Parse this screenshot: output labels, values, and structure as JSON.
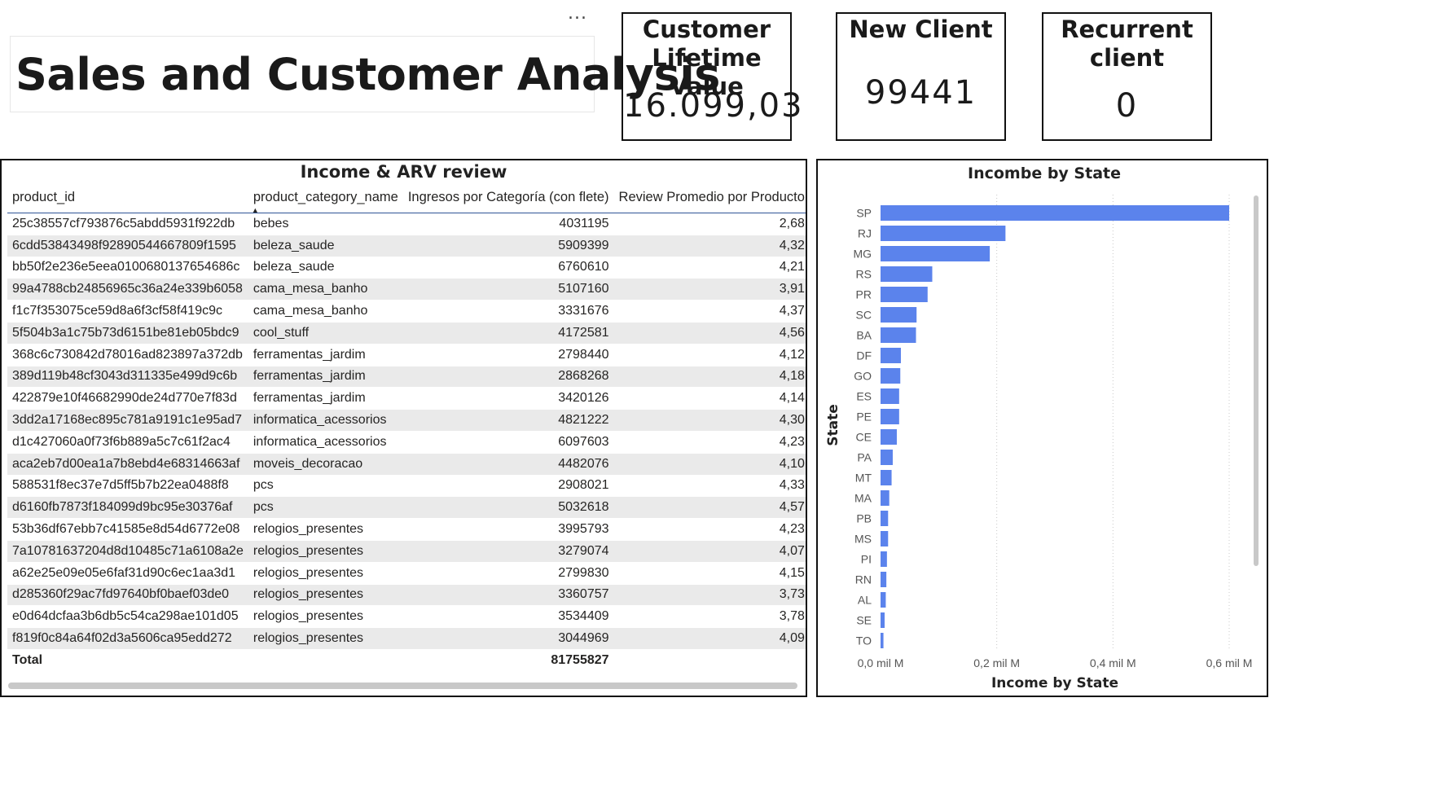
{
  "header": {
    "title": "Sales and Customer Analysis",
    "more_options": "..."
  },
  "kpis": [
    {
      "title": "Customer Lifetime Value",
      "value": "16.099,03"
    },
    {
      "title": "New Client",
      "value": "99441"
    },
    {
      "title": "Recurrent client",
      "value": "0"
    }
  ],
  "table": {
    "title": "Income & ARV review",
    "columns": [
      "product_id",
      "product_category_name",
      "Ingresos por Categoría (con flete)",
      "Review Promedio por Producto"
    ],
    "sort_indicator": "▲",
    "rows": [
      [
        "25c38557cf793876c5abdd5931f922db",
        "bebes",
        "4031195",
        "2,68"
      ],
      [
        "6cdd53843498f92890544667809f1595",
        "beleza_saude",
        "5909399",
        "4,32"
      ],
      [
        "bb50f2e236e5eea0100680137654686c",
        "beleza_saude",
        "6760610",
        "4,21"
      ],
      [
        "99a4788cb24856965c36a24e339b6058",
        "cama_mesa_banho",
        "5107160",
        "3,91"
      ],
      [
        "f1c7f353075ce59d8a6f3cf58f419c9c",
        "cama_mesa_banho",
        "3331676",
        "4,37"
      ],
      [
        "5f504b3a1c75b73d6151be81eb05bdc9",
        "cool_stuff",
        "4172581",
        "4,56"
      ],
      [
        "368c6c730842d78016ad823897a372db",
        "ferramentas_jardim",
        "2798440",
        "4,12"
      ],
      [
        "389d119b48cf3043d311335e499d9c6b",
        "ferramentas_jardim",
        "2868268",
        "4,18"
      ],
      [
        "422879e10f46682990de24d770e7f83d",
        "ferramentas_jardim",
        "3420126",
        "4,14"
      ],
      [
        "3dd2a17168ec895c781a9191c1e95ad7",
        "informatica_acessorios",
        "4821222",
        "4,30"
      ],
      [
        "d1c427060a0f73f6b889a5c7c61f2ac4",
        "informatica_acessorios",
        "6097603",
        "4,23"
      ],
      [
        "aca2eb7d00ea1a7b8ebd4e68314663af",
        "moveis_decoracao",
        "4482076",
        "4,10"
      ],
      [
        "588531f8ec37e7d5ff5b7b22ea0488f8",
        "pcs",
        "2908021",
        "4,33"
      ],
      [
        "d6160fb7873f184099d9bc95e30376af",
        "pcs",
        "5032618",
        "4,57"
      ],
      [
        "53b36df67ebb7c41585e8d54d6772e08",
        "relogios_presentes",
        "3995793",
        "4,23"
      ],
      [
        "7a10781637204d8d10485c71a6108a2e",
        "relogios_presentes",
        "3279074",
        "4,07"
      ],
      [
        "a62e25e09e05e6faf31d90c6ec1aa3d1",
        "relogios_presentes",
        "2799830",
        "4,15"
      ],
      [
        "d285360f29ac7fd97640bf0baef03de0",
        "relogios_presentes",
        "3360757",
        "3,73"
      ],
      [
        "e0d64dcfaa3b6db5c54ca298ae101d05",
        "relogios_presentes",
        "3534409",
        "3,78"
      ],
      [
        "f819f0c84a64f02d3a5606ca95edd272",
        "relogios_presentes",
        "3044969",
        "4,09"
      ]
    ],
    "total_label": "Total",
    "total_value": "81755827"
  },
  "chart_data": {
    "type": "bar",
    "orientation": "horizontal",
    "title": "Incombe by State",
    "xlabel": "Income by State",
    "ylabel": "State",
    "categories": [
      "SP",
      "RJ",
      "MG",
      "RS",
      "PR",
      "SC",
      "BA",
      "DF",
      "GO",
      "ES",
      "PE",
      "CE",
      "PA",
      "MT",
      "MA",
      "PB",
      "MS",
      "PI",
      "RN",
      "AL",
      "SE",
      "TO"
    ],
    "values": [
      0.6,
      0.215,
      0.188,
      0.089,
      0.081,
      0.062,
      0.061,
      0.035,
      0.034,
      0.032,
      0.032,
      0.028,
      0.021,
      0.019,
      0.015,
      0.013,
      0.013,
      0.011,
      0.01,
      0.009,
      0.007,
      0.005
    ],
    "xlim": [
      0,
      0.6
    ],
    "xticks": [
      "0,0 mil M",
      "0,2 mil M",
      "0,4 mil M",
      "0,6 mil M"
    ],
    "xtick_values": [
      0,
      0.2,
      0.4,
      0.6
    ],
    "bar_color": "#5b83ec",
    "grid": "vertical dotted",
    "legend": "none"
  }
}
